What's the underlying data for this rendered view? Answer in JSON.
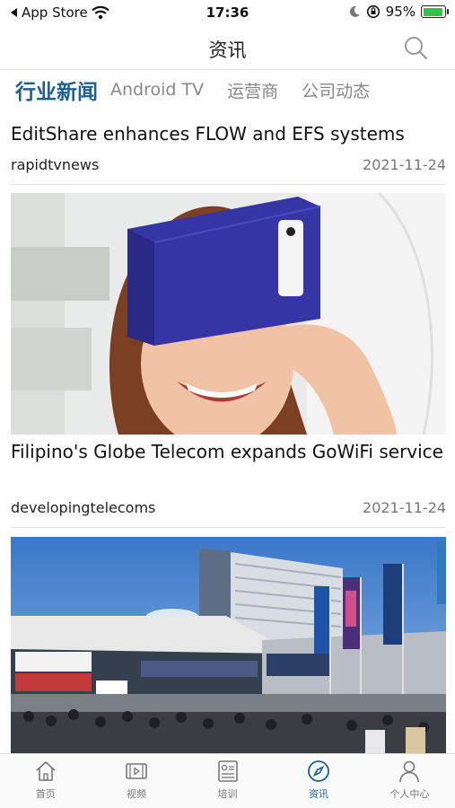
{
  "status_bar": {
    "back_label": "App Store",
    "time": "17:36",
    "battery_percent": "95%",
    "battery_level": 0.95,
    "icons": [
      "wifi-icon",
      "moon-icon",
      "rotation-lock-icon",
      "battery-icon"
    ]
  },
  "nav": {
    "title": "资讯",
    "search_icon": "search-icon"
  },
  "tabs": [
    {
      "label": "行业新闻",
      "active": true
    },
    {
      "label": "Android TV",
      "active": false
    },
    {
      "label": "运营商",
      "active": false
    },
    {
      "label": "公司动态",
      "active": false
    }
  ],
  "news": [
    {
      "title": "EditShare enhances FLOW and EFS systems",
      "source": "rapidtvnews",
      "date": "2021-11-24"
    },
    {
      "title": " Filipino's Globe Telecom expands GoWiFi service",
      "source": "developingtelecoms",
      "date": "2021-11-24"
    }
  ],
  "tab_bar": [
    {
      "label": "首页",
      "icon": "home-icon",
      "active": false
    },
    {
      "label": "视频",
      "icon": "video-icon",
      "active": false
    },
    {
      "label": "培训",
      "icon": "training-icon",
      "active": false
    },
    {
      "label": "资讯",
      "icon": "compass-icon",
      "active": true
    },
    {
      "label": "个人中心",
      "icon": "person-icon",
      "active": false
    }
  ],
  "colors": {
    "accent": "#1b5f95",
    "inactive_tab": "#888888",
    "battery": "#36c24a"
  }
}
